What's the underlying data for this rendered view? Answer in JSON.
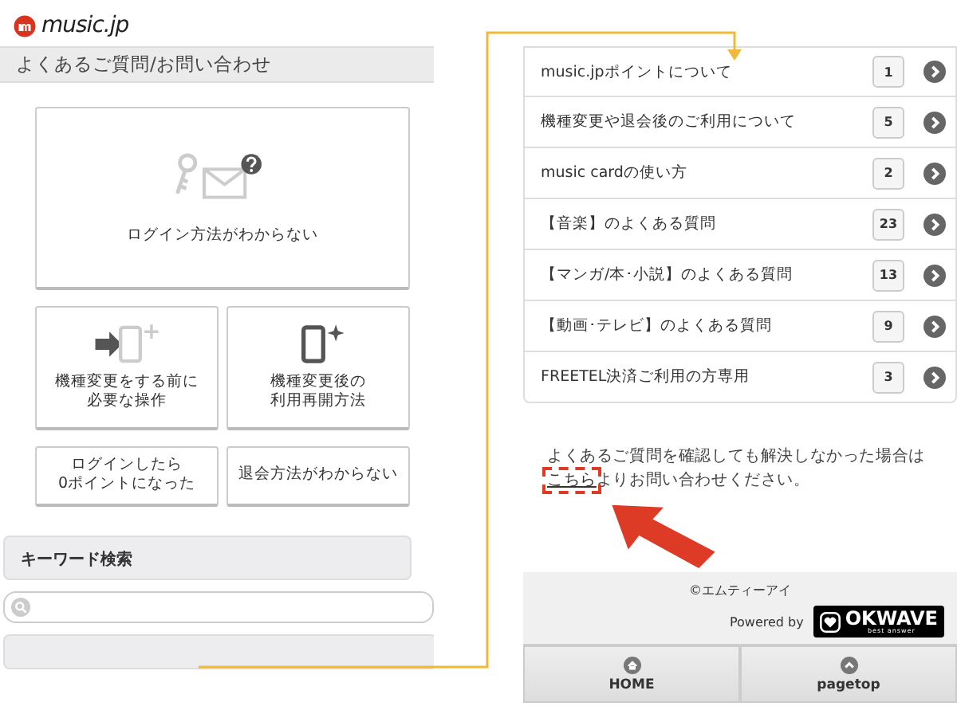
{
  "left": {
    "logo": "music.jp",
    "page_title": "よくあるご質問/お問い合わせ",
    "menu_cards": [
      {
        "kind": "login",
        "lines": [
          "ログイン方法がわからない"
        ]
      },
      {
        "kind": "before",
        "lines": [
          "機種変更をする前に",
          "必要な操作"
        ]
      },
      {
        "kind": "after",
        "lines": [
          "機種変更後の",
          "利用再開方法"
        ]
      },
      {
        "kind": "text",
        "lines": [
          "ログインしたら",
          "0ポイントになった"
        ]
      },
      {
        "kind": "text",
        "lines": [
          "退会方法がわからない"
        ]
      }
    ],
    "keyword_search": {
      "heading": "キーワード検索"
    }
  },
  "right": {
    "categories": [
      {
        "label": "music.jpポイントについて",
        "count": "1"
      },
      {
        "label": "機種変更や退会後のご利用について",
        "count": "5"
      },
      {
        "label": "music cardの使い方",
        "count": "2"
      },
      {
        "label": "【音楽】のよくある質問",
        "count": "23"
      },
      {
        "label": "【マンガ/本･小説】のよくある質問",
        "count": "13"
      },
      {
        "label": "【動画･テレビ】のよくある質問",
        "count": "9"
      },
      {
        "label": "FREETEL決済ご利用の方専用",
        "count": "3"
      }
    ],
    "notice": {
      "before": "よくあるご質問を確認しても解決しなかった場合は",
      "link": "こちら",
      "after": "よりお問い合わせください。"
    },
    "footer": {
      "copyright": "©エムティーアイ",
      "powered_by": "Powered by",
      "brand": "OKWAVE",
      "brand_tagline": "best answer"
    },
    "nav": [
      {
        "kind": "home",
        "label": "HOME"
      },
      {
        "kind": "up",
        "label": "pagetop"
      }
    ]
  }
}
